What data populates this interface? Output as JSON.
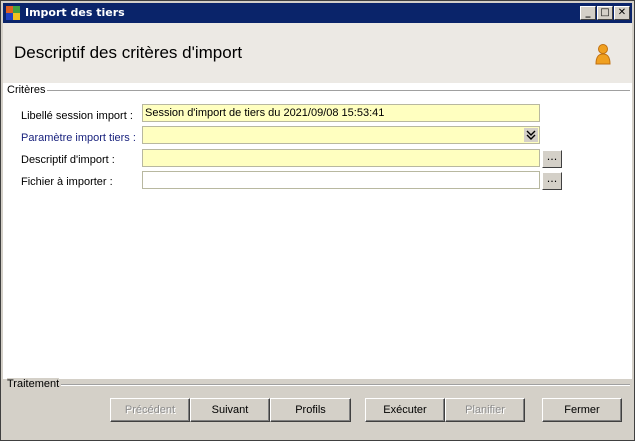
{
  "window": {
    "title": "Import des tiers",
    "minimize": "_",
    "maximize": "□",
    "close": "✕"
  },
  "header": {
    "title": "Descriptif des critères d'import"
  },
  "criteria": {
    "group_label": "Critères",
    "session_label": "Libellé session import :",
    "session_value": "Session d'import de tiers du 2021/09/08 15:53:41",
    "param_label": "Paramètre import tiers :",
    "param_value": "",
    "desc_label": "Descriptif d'import :",
    "desc_value": "",
    "file_label": "Fichier à importer :",
    "file_value": "",
    "browse": "..."
  },
  "treatment": {
    "group_label": "Traitement",
    "buttons": {
      "previous": "Précédent",
      "next": "Suivant",
      "profiles": "Profils",
      "execute": "Exécuter",
      "schedule": "Planifier",
      "close": "Fermer"
    }
  },
  "colors": {
    "titlebar": "#0a246a",
    "field_bg": "#ffffc0",
    "link_label": "#1a237e"
  }
}
